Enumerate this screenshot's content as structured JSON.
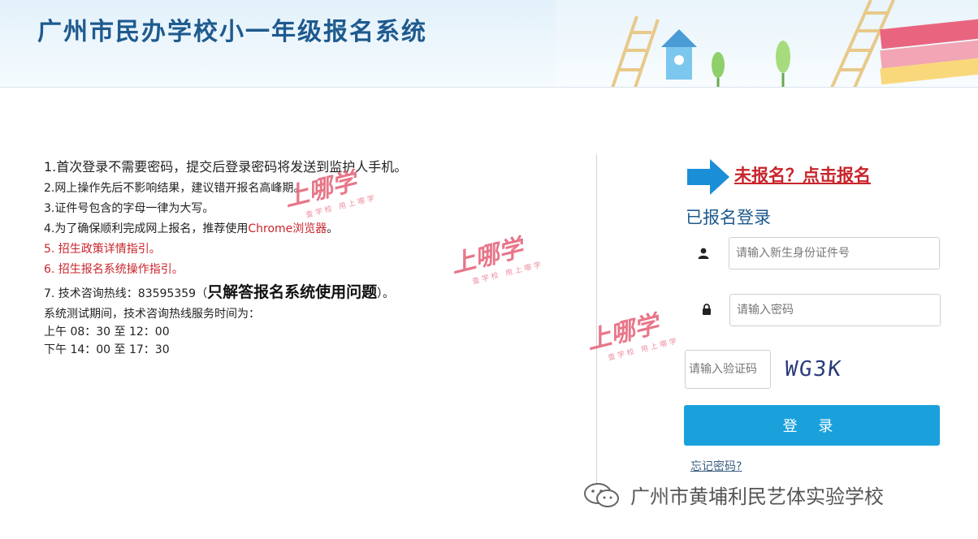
{
  "header": {
    "title": "广州市民办学校小一年级报名系统"
  },
  "notes": [
    {
      "text": "1.首次登录不需要密码，提交后登录密码将发送到监护人手机。",
      "style": "first"
    },
    {
      "text": "2.网上操作先后不影响结果，建议错开报名高峰期。",
      "style": "normal"
    },
    {
      "text": "3.证件号包含的字母一律为大写。",
      "style": "normal"
    },
    {
      "text": "4.为了确保顺利完成网上报名，推荐使用",
      "style": "normal",
      "red_suffix": "Chrome浏览器",
      "suffix": "。"
    },
    {
      "text": "5. 招生政策详情指引。",
      "style": "red"
    },
    {
      "text": "6. 招生报名系统操作指引。",
      "style": "red"
    }
  ],
  "hotline": {
    "prefix": "7. 技术咨询热线：83595359（",
    "emphasis": "只解答报名系统使用问题",
    "suffix": "）。",
    "period_label": "系统测试期间，技术咨询热线服务时间为：",
    "morning": "上午 08：30 至 12：00",
    "afternoon": "下午 14：00 至 17：30"
  },
  "register": {
    "link_label": "未报名？点击报名",
    "arrow_icon": "right-arrow-icon"
  },
  "login": {
    "title": "已报名登录",
    "id_placeholder": "请输入新生身份证件号",
    "password_placeholder": "请输入密码",
    "captcha_placeholder": "请输入验证码",
    "captcha_text": "WG3K",
    "submit_label": "登 录",
    "forgot_label": "忘记密码?"
  },
  "watermark": {
    "brand": "上哪学",
    "tagline": "查学校 用上哪学"
  },
  "footer": {
    "account": "广州市黄埔利民艺体实验学校"
  },
  "colors": {
    "title_blue": "#1e5a8e",
    "accent_red": "#c8252c",
    "button_blue": "#1aa1dc",
    "watermark_pink": "#e25068"
  }
}
